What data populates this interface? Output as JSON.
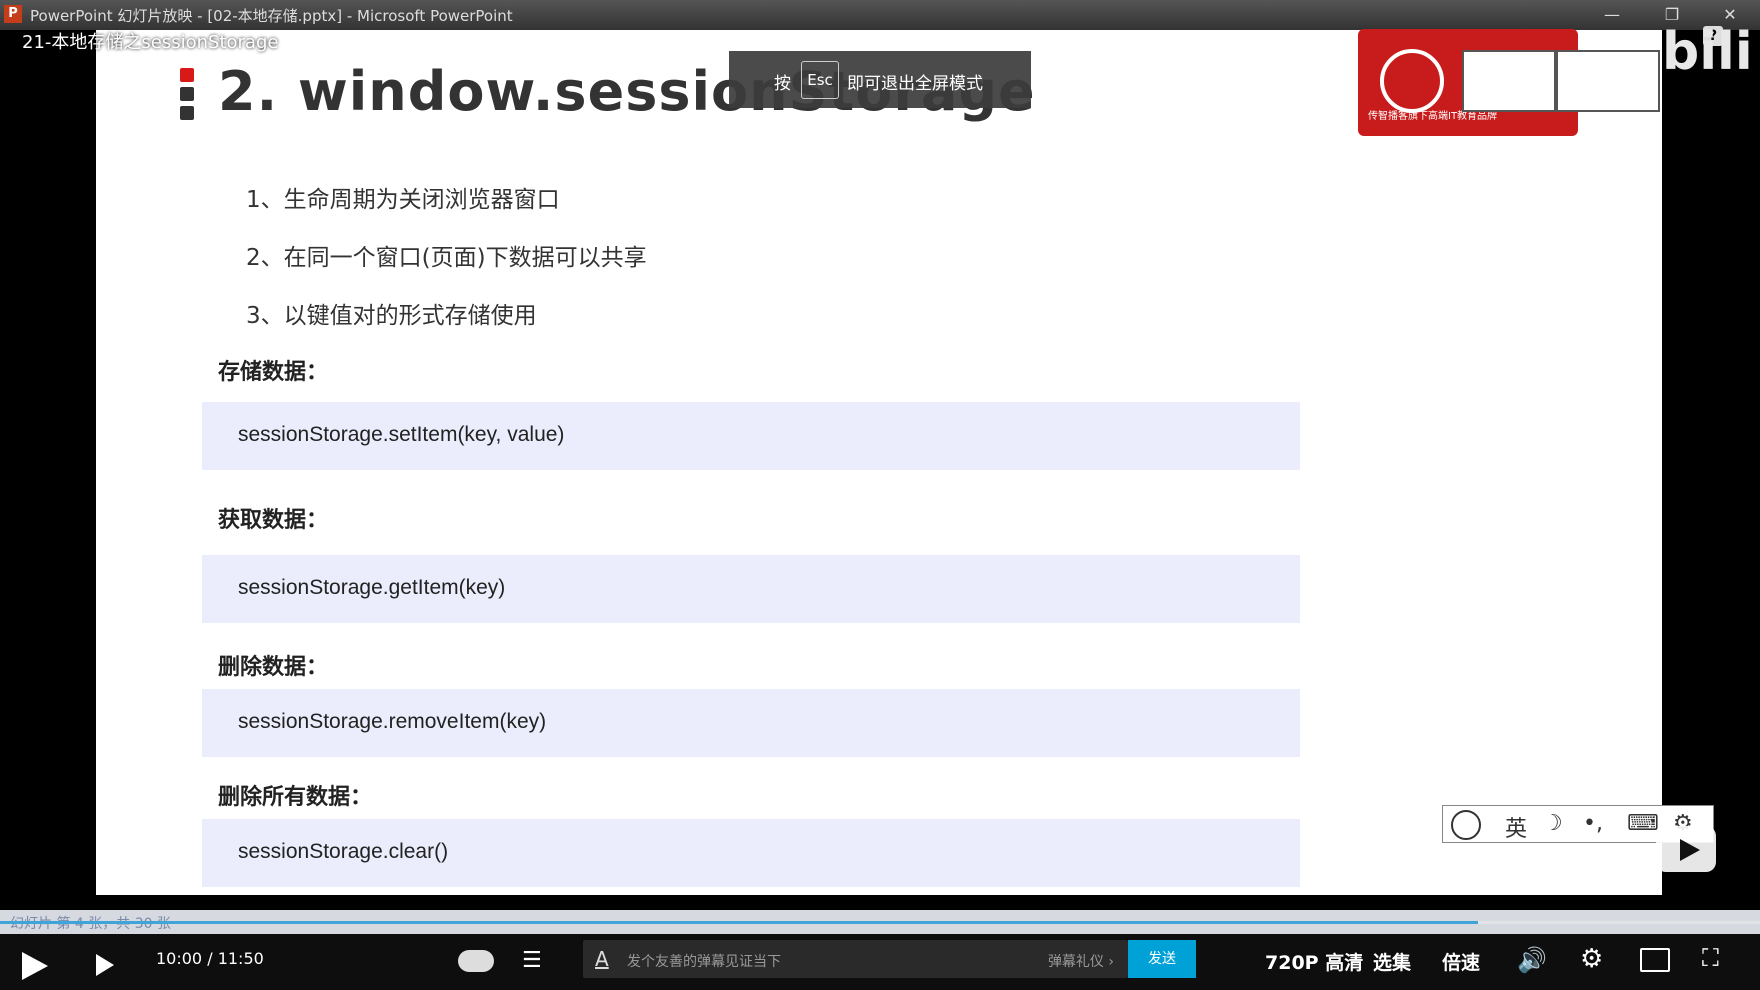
{
  "window": {
    "app_title": "PowerPoint 幻灯片放映 - [02-本地存储.pptx] - Microsoft PowerPoint",
    "app_icon": "P",
    "minimize": "—",
    "restore": "❐",
    "close": "✕"
  },
  "video": {
    "title": "21-本地存储之sessionStorage"
  },
  "esc_toast": {
    "prefix": "按",
    "key": "Esc",
    "suffix": "即可退出全屏模式"
  },
  "brand": {
    "tagline": "传智播客旗下高端IT教育品牌",
    "site_logo": "bili",
    "help": "?"
  },
  "slide": {
    "heading": "2. window.sessionStorage",
    "points": [
      "1、生命周期为关闭浏览器窗口",
      "2、在同一个窗口(页面)下数据可以共享",
      "3、以键值对的形式存储使用"
    ],
    "sections": [
      {
        "label": "存储数据：",
        "code": "sessionStorage.setItem(key, value)"
      },
      {
        "label": "获取数据：",
        "code": "sessionStorage.getItem(key)"
      },
      {
        "label": "删除数据：",
        "code": "sessionStorage.removeItem(key)"
      },
      {
        "label": "删除所有数据：",
        "code": "sessionStorage.clear()"
      }
    ],
    "marker_colors": [
      "#d91818",
      "#333333",
      "#333333"
    ]
  },
  "ime_bar": {
    "lang": "英",
    "moon": "☽",
    "punct": "•,",
    "keyboard": "⌨",
    "gear": "⚙"
  },
  "ppt_status": {
    "text": "幻灯片 第 4 张，共 30 张"
  },
  "player": {
    "progress_fraction": 0.84,
    "current_time": "10:00",
    "separator": "/",
    "total_time": "11:50",
    "danmaku_placeholder": "发个友善的弹幕见证当下",
    "danmaku_etiquette": "弹幕礼仪 ›",
    "send_label": "发送",
    "quality_label": "720P 高清",
    "episodes_label": "选集",
    "speed_label": "倍速",
    "volume_icon": "🔊",
    "settings_icon": "⚙",
    "fullscreen_icon": "⛶",
    "accent_color": "#00a1d6"
  }
}
